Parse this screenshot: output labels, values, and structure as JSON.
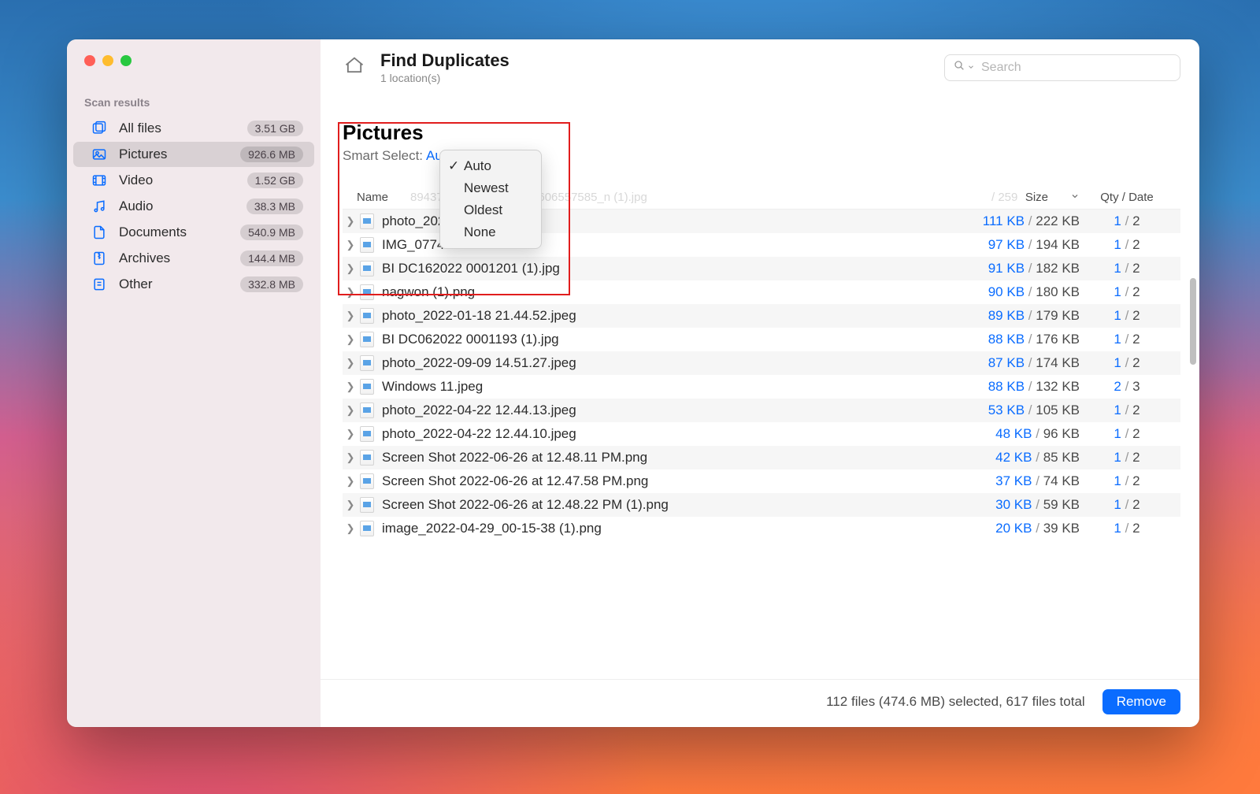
{
  "header": {
    "title": "Find Duplicates",
    "subtitle": "1 location(s)",
    "search_placeholder": "Search"
  },
  "sidebar": {
    "heading": "Scan results",
    "items": [
      {
        "label": "All files",
        "badge": "3.51 GB",
        "icon": "files-icon",
        "active": false
      },
      {
        "label": "Pictures",
        "badge": "926.6 MB",
        "icon": "pictures-icon",
        "active": true
      },
      {
        "label": "Video",
        "badge": "1.52 GB",
        "icon": "video-icon",
        "active": false
      },
      {
        "label": "Audio",
        "badge": "38.3 MB",
        "icon": "audio-icon",
        "active": false
      },
      {
        "label": "Documents",
        "badge": "540.9 MB",
        "icon": "documents-icon",
        "active": false
      },
      {
        "label": "Archives",
        "badge": "144.4 MB",
        "icon": "archives-icon",
        "active": false
      },
      {
        "label": "Other",
        "badge": "332.8 MB",
        "icon": "other-icon",
        "active": false
      }
    ]
  },
  "section": {
    "title": "Pictures",
    "smart_select_label": "Smart Select:",
    "smart_select_value": "Auto"
  },
  "dropdown": {
    "options": [
      "Auto",
      "Newest",
      "Oldest",
      "None"
    ],
    "selected": "Auto"
  },
  "columns": {
    "name": "Name",
    "size": "Size",
    "qty": "Qty / Date",
    "ghost_name": "8943706…11…1492359606557585_n (1).jpg",
    "ghost_size": "/ 259"
  },
  "files": [
    {
      "name": "photo_2022-…0.31.jpeg",
      "size_sel": "111 KB",
      "size_tot": "222 KB",
      "qty_sel": "1",
      "qty_tot": "2"
    },
    {
      "name": "IMG_0774…",
      "size_sel": "97 KB",
      "size_tot": "194 KB",
      "qty_sel": "1",
      "qty_tot": "2"
    },
    {
      "name": "BI DC162022 0001201 (1).jpg",
      "size_sel": "91 KB",
      "size_tot": "182 KB",
      "qty_sel": "1",
      "qty_tot": "2"
    },
    {
      "name": "nagwon (1).png",
      "size_sel": "90 KB",
      "size_tot": "180 KB",
      "qty_sel": "1",
      "qty_tot": "2"
    },
    {
      "name": "photo_2022-01-18 21.44.52.jpeg",
      "size_sel": "89 KB",
      "size_tot": "179 KB",
      "qty_sel": "1",
      "qty_tot": "2"
    },
    {
      "name": "BI DC062022 0001193 (1).jpg",
      "size_sel": "88 KB",
      "size_tot": "176 KB",
      "qty_sel": "1",
      "qty_tot": "2"
    },
    {
      "name": "photo_2022-09-09 14.51.27.jpeg",
      "size_sel": "87 KB",
      "size_tot": "174 KB",
      "qty_sel": "1",
      "qty_tot": "2"
    },
    {
      "name": "Windows 11.jpeg",
      "size_sel": "88 KB",
      "size_tot": "132 KB",
      "qty_sel": "2",
      "qty_tot": "3"
    },
    {
      "name": "photo_2022-04-22 12.44.13.jpeg",
      "size_sel": "53 KB",
      "size_tot": "105 KB",
      "qty_sel": "1",
      "qty_tot": "2"
    },
    {
      "name": "photo_2022-04-22 12.44.10.jpeg",
      "size_sel": "48 KB",
      "size_tot": "96 KB",
      "qty_sel": "1",
      "qty_tot": "2"
    },
    {
      "name": "Screen Shot 2022-06-26 at 12.48.11 PM.png",
      "size_sel": "42 KB",
      "size_tot": "85 KB",
      "qty_sel": "1",
      "qty_tot": "2"
    },
    {
      "name": "Screen Shot 2022-06-26 at 12.47.58 PM.png",
      "size_sel": "37 KB",
      "size_tot": "74 KB",
      "qty_sel": "1",
      "qty_tot": "2"
    },
    {
      "name": "Screen Shot 2022-06-26 at 12.48.22 PM (1).png",
      "size_sel": "30 KB",
      "size_tot": "59 KB",
      "qty_sel": "1",
      "qty_tot": "2"
    },
    {
      "name": "image_2022-04-29_00-15-38 (1).png",
      "size_sel": "20 KB",
      "size_tot": "39 KB",
      "qty_sel": "1",
      "qty_tot": "2"
    }
  ],
  "footer": {
    "status": "112 files (474.6 MB) selected, 617 files total",
    "remove_label": "Remove"
  }
}
